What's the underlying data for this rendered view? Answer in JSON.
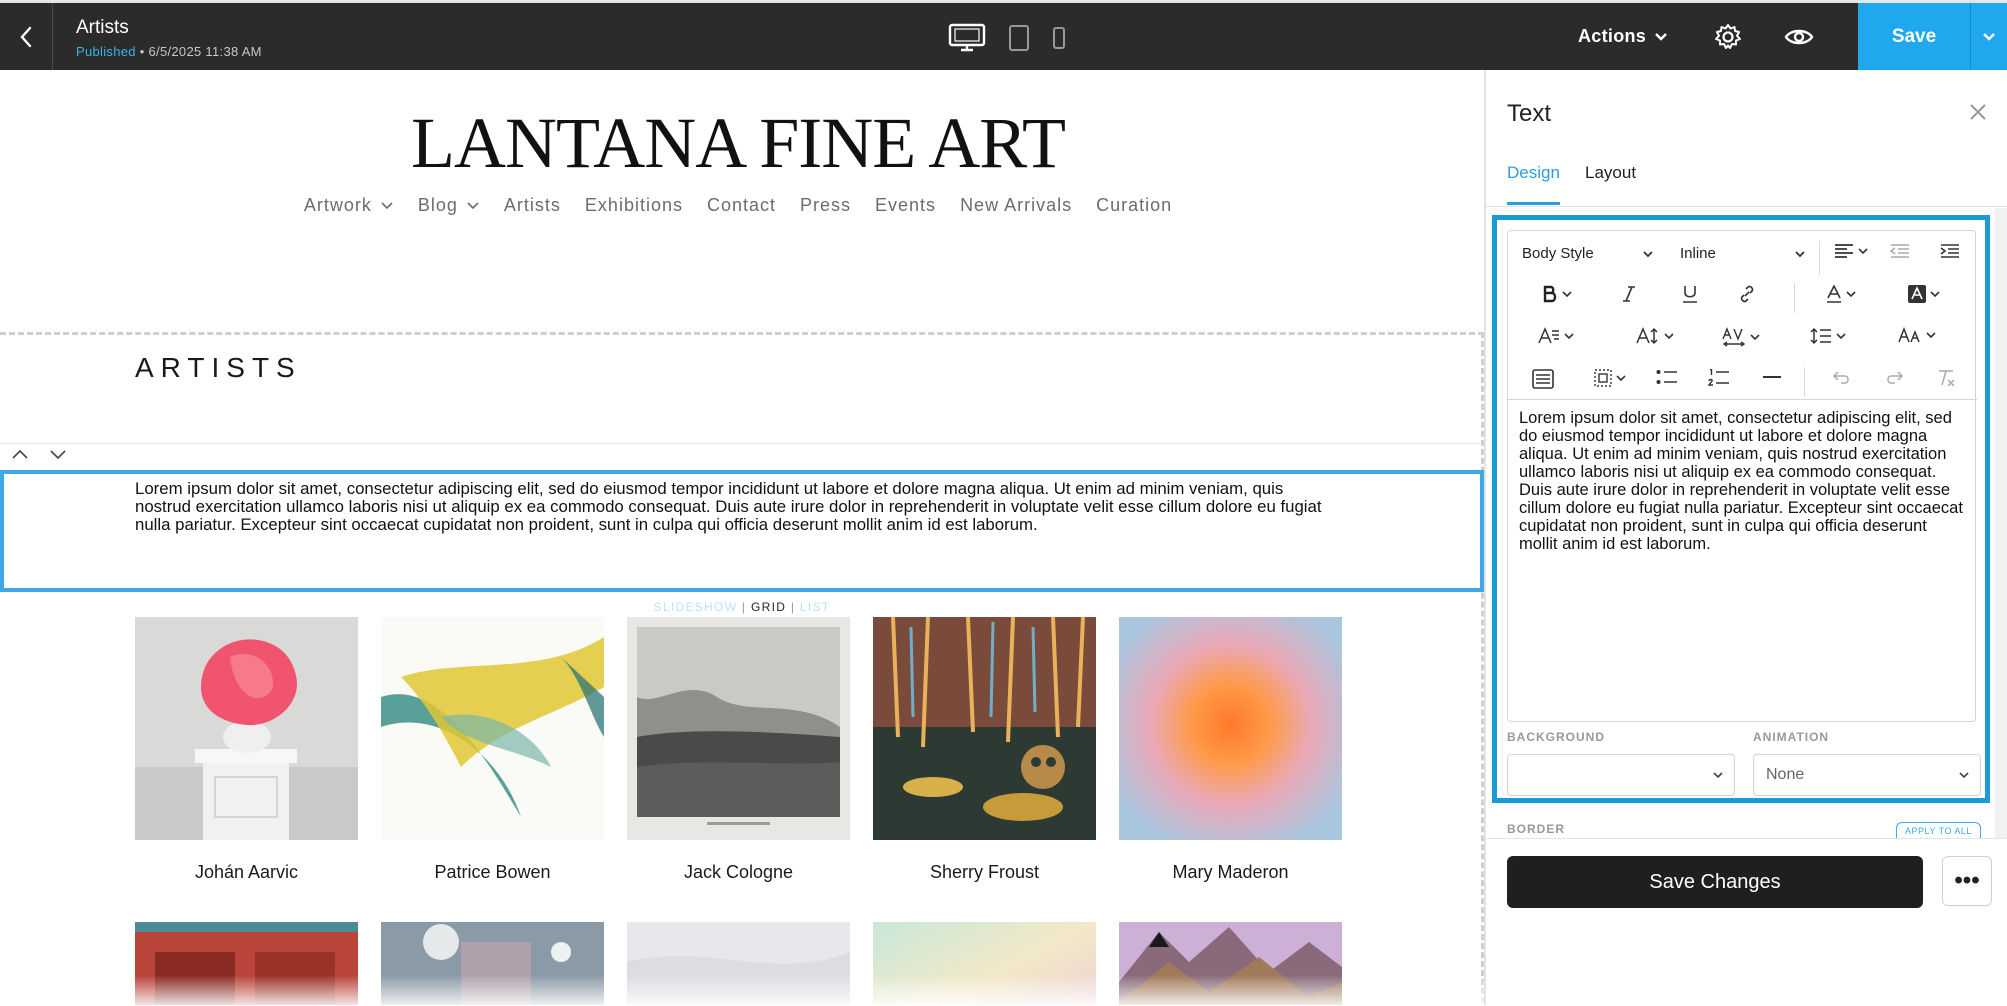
{
  "topbar": {
    "back_icon": "chevron-left-icon",
    "page_title": "Artists",
    "status": "Published",
    "status_separator": "•",
    "timestamp": "6/5/2025 11:38 AM",
    "devices": [
      "desktop-icon",
      "tablet-icon",
      "mobile-icon"
    ],
    "actions_label": "Actions",
    "save_label": "Save",
    "accent": "#20a8ef"
  },
  "site": {
    "logo": "LANTANA FINE ART",
    "nav": [
      {
        "label": "Artwork",
        "dropdown": true
      },
      {
        "label": "Blog",
        "dropdown": true
      },
      {
        "label": "Artists",
        "dropdown": false
      },
      {
        "label": "Exhibitions",
        "dropdown": false
      },
      {
        "label": "Contact",
        "dropdown": false
      },
      {
        "label": "Press",
        "dropdown": false
      },
      {
        "label": "Events",
        "dropdown": false
      },
      {
        "label": "New Arrivals",
        "dropdown": false
      },
      {
        "label": "Curation",
        "dropdown": false
      }
    ],
    "section_heading": "ARTISTS",
    "body_text": "Lorem ipsum dolor sit amet, consectetur adipiscing elit, sed do eiusmod tempor incididunt ut labore et dolore magna aliqua. Ut enim ad minim veniam, quis nostrud exercitation ullamco laboris nisi ut aliquip ex ea commodo consequat. Duis aute irure dolor in reprehenderit in voluptate velit esse cillum dolore eu fugiat nulla pariatur. Excepteur sint occaecat cupidatat non proident, sunt in culpa qui officia deserunt mollit anim id est laborum.",
    "view_toggle": {
      "slideshow": "SLIDESHOW",
      "sep": "|",
      "grid": "GRID",
      "list": "LIST"
    },
    "artists": [
      {
        "name": "Johán Aarvic"
      },
      {
        "name": "Patrice Bowen"
      },
      {
        "name": "Jack Cologne"
      },
      {
        "name": "Sherry Froust"
      },
      {
        "name": "Mary Maderon"
      }
    ]
  },
  "panel": {
    "title": "Text",
    "tabs": {
      "design": "Design",
      "layout": "Layout"
    },
    "style_select": "Body Style",
    "display_select": "Inline",
    "editor_text": "Lorem ipsum dolor sit amet, consectetur adipiscing elit, sed do eiusmod tempor incididunt ut labore et dolore magna aliqua. Ut enim ad minim veniam, quis nostrud exercitation ullamco laboris nisi ut aliquip ex ea commodo consequat. Duis aute irure dolor in reprehenderit in voluptate velit esse cillum dolore eu fugiat nulla pariatur. Excepteur sint occaecat cupidatat non proident, sunt in culpa qui officia deserunt mollit anim id est laborum.",
    "background_label": "BACKGROUND",
    "animation_label": "ANIMATION",
    "animation_value": "None",
    "border_label": "BORDER",
    "apply_all": "APPLY TO ALL",
    "save_changes": "Save Changes",
    "more": "•••"
  }
}
